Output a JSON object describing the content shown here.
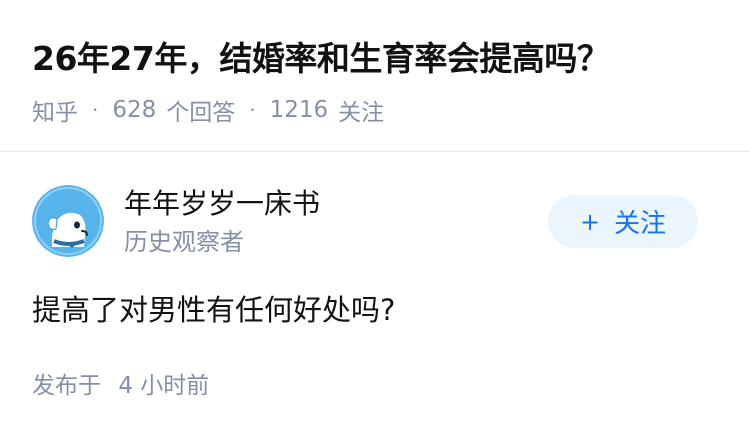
{
  "question": {
    "title": "26年27年，结婚率和生育率会提高吗？",
    "source": "知乎",
    "separator": "·",
    "answer_count": "628",
    "answer_label": "个回答",
    "follower_count": "1216",
    "follower_label": "关注"
  },
  "answer": {
    "author_name": "年年岁岁一床书",
    "author_bio": "历史观察者",
    "follow_plus": "+",
    "follow_label": "关注",
    "content": "提高了对男性有任何好处吗?",
    "time_label": "发布于",
    "time_value": "4 小时前"
  },
  "colors": {
    "meta_gray": "#8590a6",
    "accent_blue": "#1772f6",
    "follow_bg": "#ebf5fd",
    "avatar_bg": "#56b4ea"
  }
}
